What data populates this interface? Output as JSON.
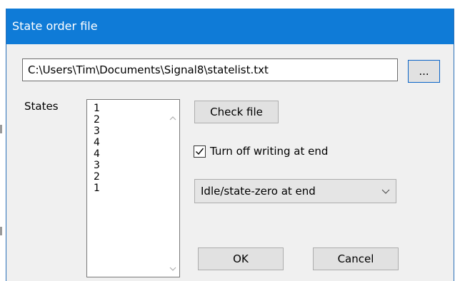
{
  "window": {
    "title": "State order file"
  },
  "file": {
    "path": "C:\\Users\\Tim\\Documents\\Signal8\\statelist.txt",
    "browse_label": "..."
  },
  "states": {
    "label": "States",
    "items": [
      "1",
      "2",
      "3",
      "4",
      "4",
      "3",
      "2",
      "1"
    ]
  },
  "buttons": {
    "check_file": "Check file",
    "ok": "OK",
    "cancel": "Cancel"
  },
  "options": {
    "turn_off_writing": {
      "label": "Turn off writing at end",
      "checked": true
    },
    "end_state": {
      "selected": "Idle/state-zero at end"
    }
  },
  "colors": {
    "title_bar": "#0f7bd7",
    "dialog_bg": "#f0f0f0",
    "focus_border": "#0a64c8"
  },
  "icons": {
    "scroll_up": "chevron-up-icon",
    "scroll_down": "chevron-down-icon",
    "dropdown": "chevron-down-icon",
    "checkbox": "checkmark-icon"
  }
}
